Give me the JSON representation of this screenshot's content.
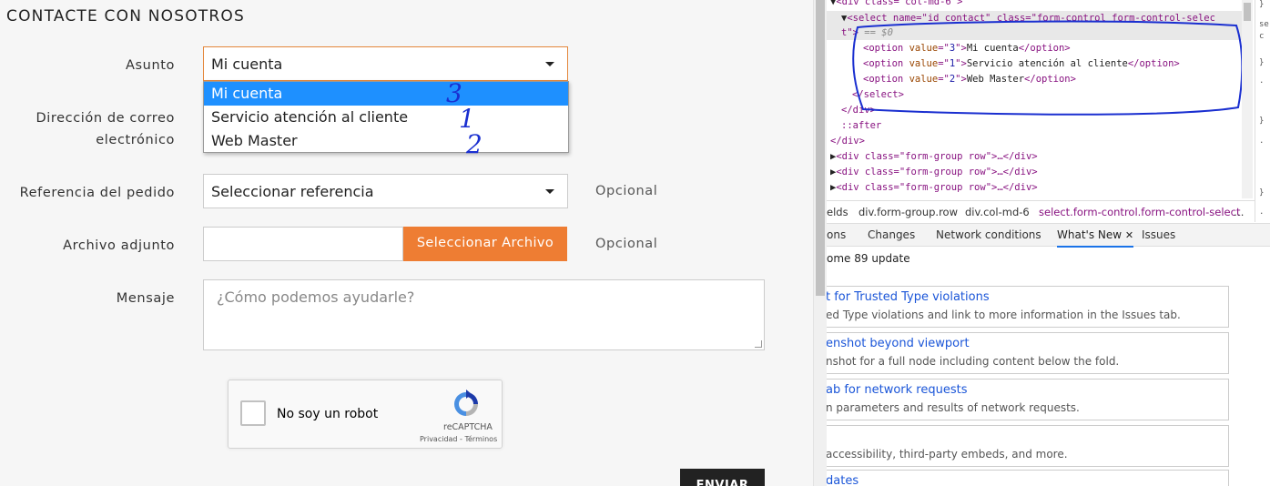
{
  "page": {
    "heading": "CONTACTE CON NOSOTROS",
    "subject": {
      "label": "Asunto",
      "value": "Mi cuenta",
      "options": [
        "Mi cuenta",
        "Servicio atención al cliente",
        "Web Master"
      ]
    },
    "email": {
      "label_line1": "Dirección de correo",
      "label_line2": "electrónico"
    },
    "order": {
      "label": "Referencia del pedido",
      "value": "Seleccionar referencia",
      "optional": "Opcional"
    },
    "attachment": {
      "label": "Archivo adjunto",
      "button": "Seleccionar Archivo",
      "optional": "Opcional"
    },
    "message": {
      "label": "Mensaje",
      "placeholder": "¿Cómo podemos ayudarle?"
    },
    "captcha": {
      "checkbox_label": "No soy un robot",
      "brand": "reCAPTCHA",
      "links": "Privacidad - Términos"
    },
    "send_button": "ENVIAR",
    "annotations": [
      "3",
      "1",
      "2"
    ]
  },
  "devtools": {
    "dom": {
      "line0_tag": "<div class=\"col-md-6\">",
      "select_open": "<select name=\"id_contact\" class=\"form-control form-control-selec",
      "select_cont": "t\">",
      "eq": " == $0",
      "options": [
        {
          "value": "3",
          "text": "Mi cuenta"
        },
        {
          "value": "1",
          "text": "Servicio atención al cliente"
        },
        {
          "value": "2",
          "text": "Web Master"
        }
      ],
      "select_close": "</select>",
      "div_close": "</div>",
      "after": "::after",
      "div_close2": "</div>",
      "rows": [
        "<div class=\"form-group row\">…</div>",
        "<div class=\"form-group row\">…</div>",
        "<div class=\"form-group row\">…</div>"
      ]
    },
    "breadcrumbs": [
      "elds",
      "div.form-group.row",
      "div.col-md-6",
      "select.form-control.form-control-select",
      "…"
    ],
    "tabs": [
      "ons",
      "Changes",
      "Network conditions",
      "What's New",
      "Issues"
    ],
    "active_tab": "What's New",
    "tab_close": "✕",
    "drawer_title": "ome 89 update",
    "cards": [
      {
        "title": "t for Trusted Type violations",
        "desc": "ed Type violations and link to more information in the Issues tab."
      },
      {
        "title": "enshot beyond viewport",
        "desc": "nshot for a full node including content below the fold."
      },
      {
        "title": "ab for network requests",
        "desc": "n parameters and results of network requests."
      },
      {
        "title": "",
        "desc": " accessibility, third-party embeds, and more."
      },
      {
        "title": "dates",
        "desc": ""
      }
    ],
    "side_text": [
      "}",
      "se",
      "c",
      "}",
      ".",
      "}",
      ".",
      "}",
      "."
    ]
  }
}
